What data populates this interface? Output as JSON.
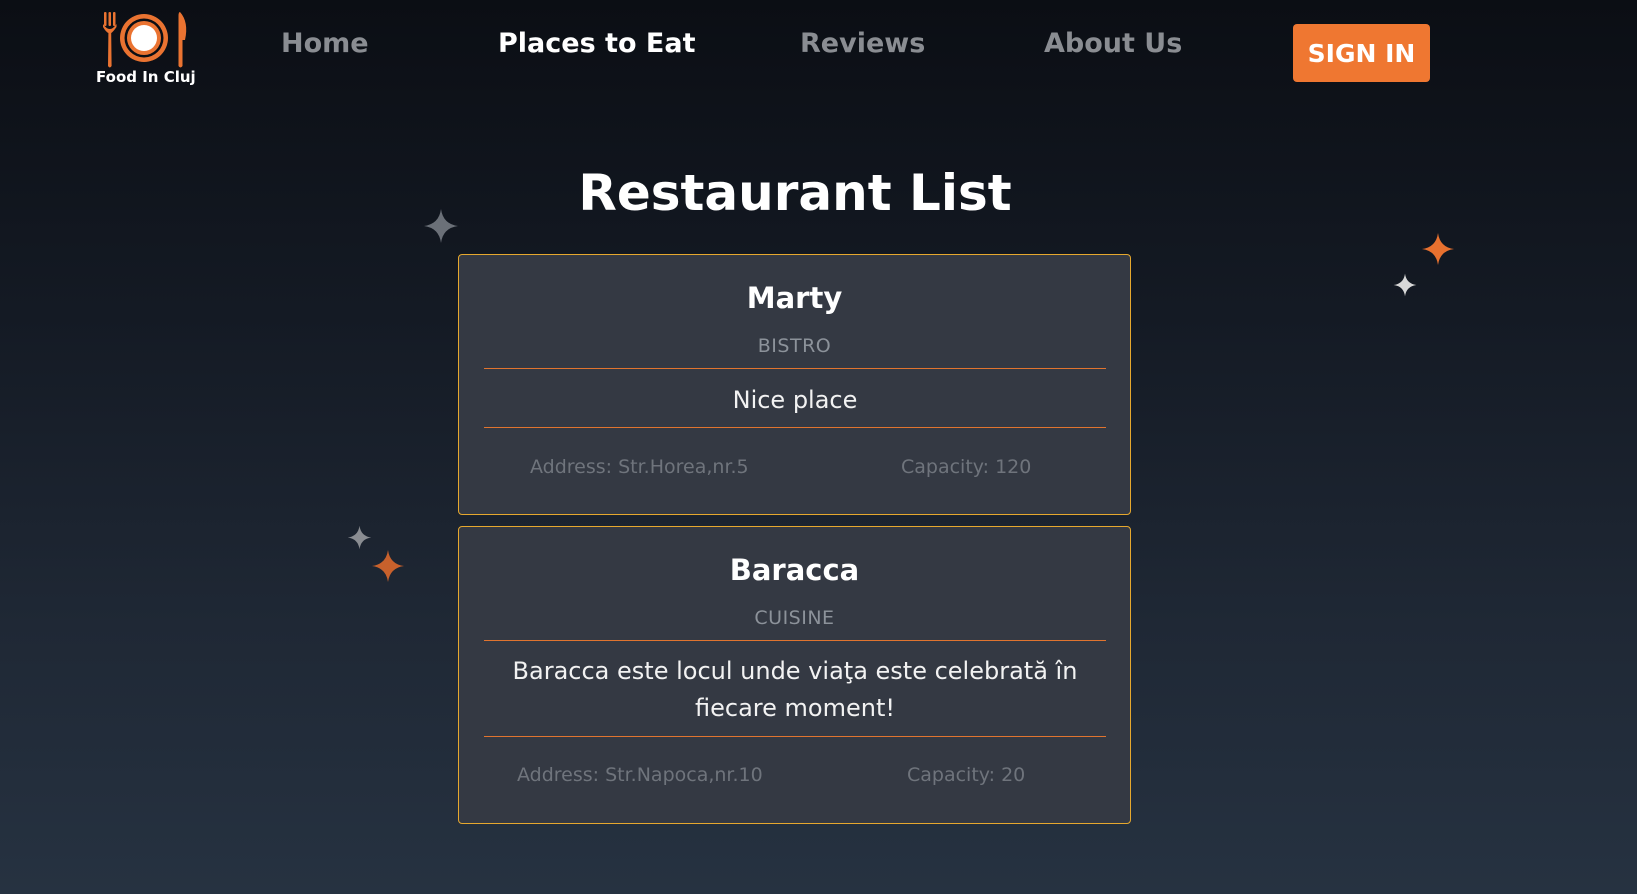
{
  "nav": {
    "logo_text": "Food In Cluj",
    "links": [
      {
        "label": "Home"
      },
      {
        "label": "Places to Eat"
      },
      {
        "label": "Reviews"
      },
      {
        "label": "About Us"
      }
    ],
    "signin_label": "SIGN IN"
  },
  "page": {
    "title": "Restaurant List"
  },
  "restaurants": [
    {
      "name": "Marty",
      "type": "BISTRO",
      "description": "Nice place",
      "address": "Address: Str.Horea,nr.5",
      "capacity": "Capacity: 120"
    },
    {
      "name": "Baracca",
      "type": "CUISINE",
      "description": "Baracca este locul unde viaţa este celebrată în fiecare moment!",
      "address": "Address: Str.Napoca,nr.10",
      "capacity": "Capacity: 20"
    }
  ],
  "theme": {
    "accent": "#ef7731",
    "card_background": "#343943",
    "card_border": "#e6a82e",
    "divider": "#e0742f"
  },
  "icons": {
    "logo": "plate-fork-knife-logo-icon",
    "decoration": "sparkle-icon"
  }
}
